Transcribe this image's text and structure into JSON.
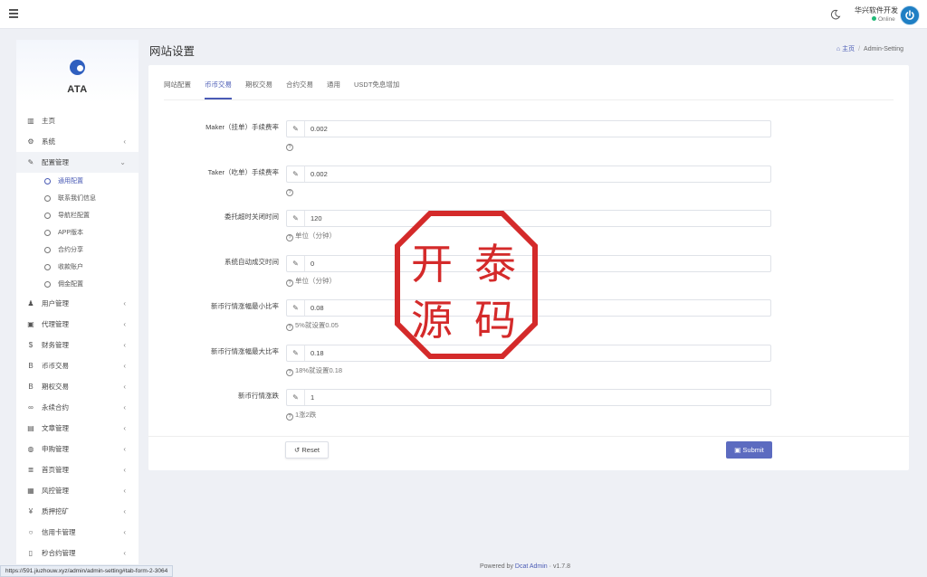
{
  "topbar": {
    "user_name": "华兴软件开发",
    "user_status": "Online"
  },
  "brand": {
    "name": "ATA"
  },
  "sidebar": {
    "items": [
      {
        "label": "主页",
        "icon": "bar-chart-icon",
        "glyph": "▥",
        "arrow": ""
      },
      {
        "label": "系统",
        "icon": "gear-icon",
        "glyph": "⚙",
        "arrow": "‹"
      },
      {
        "label": "配置管理",
        "icon": "wrench-icon",
        "glyph": "✎",
        "arrow": "⌄"
      }
    ],
    "sub_items": [
      {
        "label": "通用配置",
        "active": true
      },
      {
        "label": "联系我们信息"
      },
      {
        "label": "导航栏配置"
      },
      {
        "label": "APP版本"
      },
      {
        "label": "合约分享"
      },
      {
        "label": "收款账户"
      },
      {
        "label": "佣金配置"
      }
    ],
    "items_after": [
      {
        "label": "用户管理",
        "icon": "user-icon",
        "glyph": "♟"
      },
      {
        "label": "代理管理",
        "icon": "id-card-icon",
        "glyph": "▣"
      },
      {
        "label": "财务管理",
        "icon": "dollar-icon",
        "glyph": "$"
      },
      {
        "label": "币币交易",
        "icon": "bitcoin-icon",
        "glyph": "B"
      },
      {
        "label": "期权交易",
        "icon": "bitcoin-icon",
        "glyph": "B"
      },
      {
        "label": "永续合约",
        "icon": "link-icon",
        "glyph": "∞"
      },
      {
        "label": "文章管理",
        "icon": "newspaper-icon",
        "glyph": "▤"
      },
      {
        "label": "申购管理",
        "icon": "globe-icon",
        "glyph": "◍"
      },
      {
        "label": "首页管理",
        "icon": "list-icon",
        "glyph": "≣"
      },
      {
        "label": "风控管理",
        "icon": "table-icon",
        "glyph": "▦"
      },
      {
        "label": "质押挖矿",
        "icon": "yen-icon",
        "glyph": "¥"
      },
      {
        "label": "信用卡管理",
        "icon": "circle-icon",
        "glyph": "○"
      },
      {
        "label": "秒合约管理",
        "icon": "file-icon",
        "glyph": "▯"
      }
    ]
  },
  "header": {
    "title": "网站设置",
    "breadcrumb_home": "主页",
    "breadcrumb_current": "Admin-Setting"
  },
  "tabs": [
    "网站配置",
    "币币交易",
    "期权交易",
    "合约交易",
    "通用",
    "USDT免息增加"
  ],
  "form": [
    {
      "label": "Maker（挂单）手续费率",
      "value": "0.002",
      "help": ""
    },
    {
      "label": "Taker（吃单）手续费率",
      "value": "0.002",
      "help": ""
    },
    {
      "label": "委托超时关闭时间",
      "value": "120",
      "help": "单位（分钟）"
    },
    {
      "label": "系统自动成交时间",
      "value": "0",
      "help": "单位（分钟）"
    },
    {
      "label": "新币行情涨幅最小比率",
      "value": "0.08",
      "help": "5%就设置0.05"
    },
    {
      "label": "新币行情涨幅最大比率",
      "value": "0.18",
      "help": "18%就设置0.18"
    },
    {
      "label": "新币行情涨跌",
      "value": "1",
      "help": "1涨2跌"
    }
  ],
  "buttons": {
    "reset": "Reset",
    "submit": "Submit"
  },
  "stamp": {
    "chars": [
      "开",
      "泰",
      "源",
      "码"
    ],
    "color": "#d42a2a"
  },
  "footer": {
    "powered_by": "Powered by",
    "link": "Dcat Admin",
    "version": "v1.7.8"
  },
  "status_url": "https://591.jiuzhouw.xyz/admin/admin-setting#tab-form-2-3064",
  "colors": {
    "accent": "#5c6bc0",
    "online": "#21b978"
  }
}
